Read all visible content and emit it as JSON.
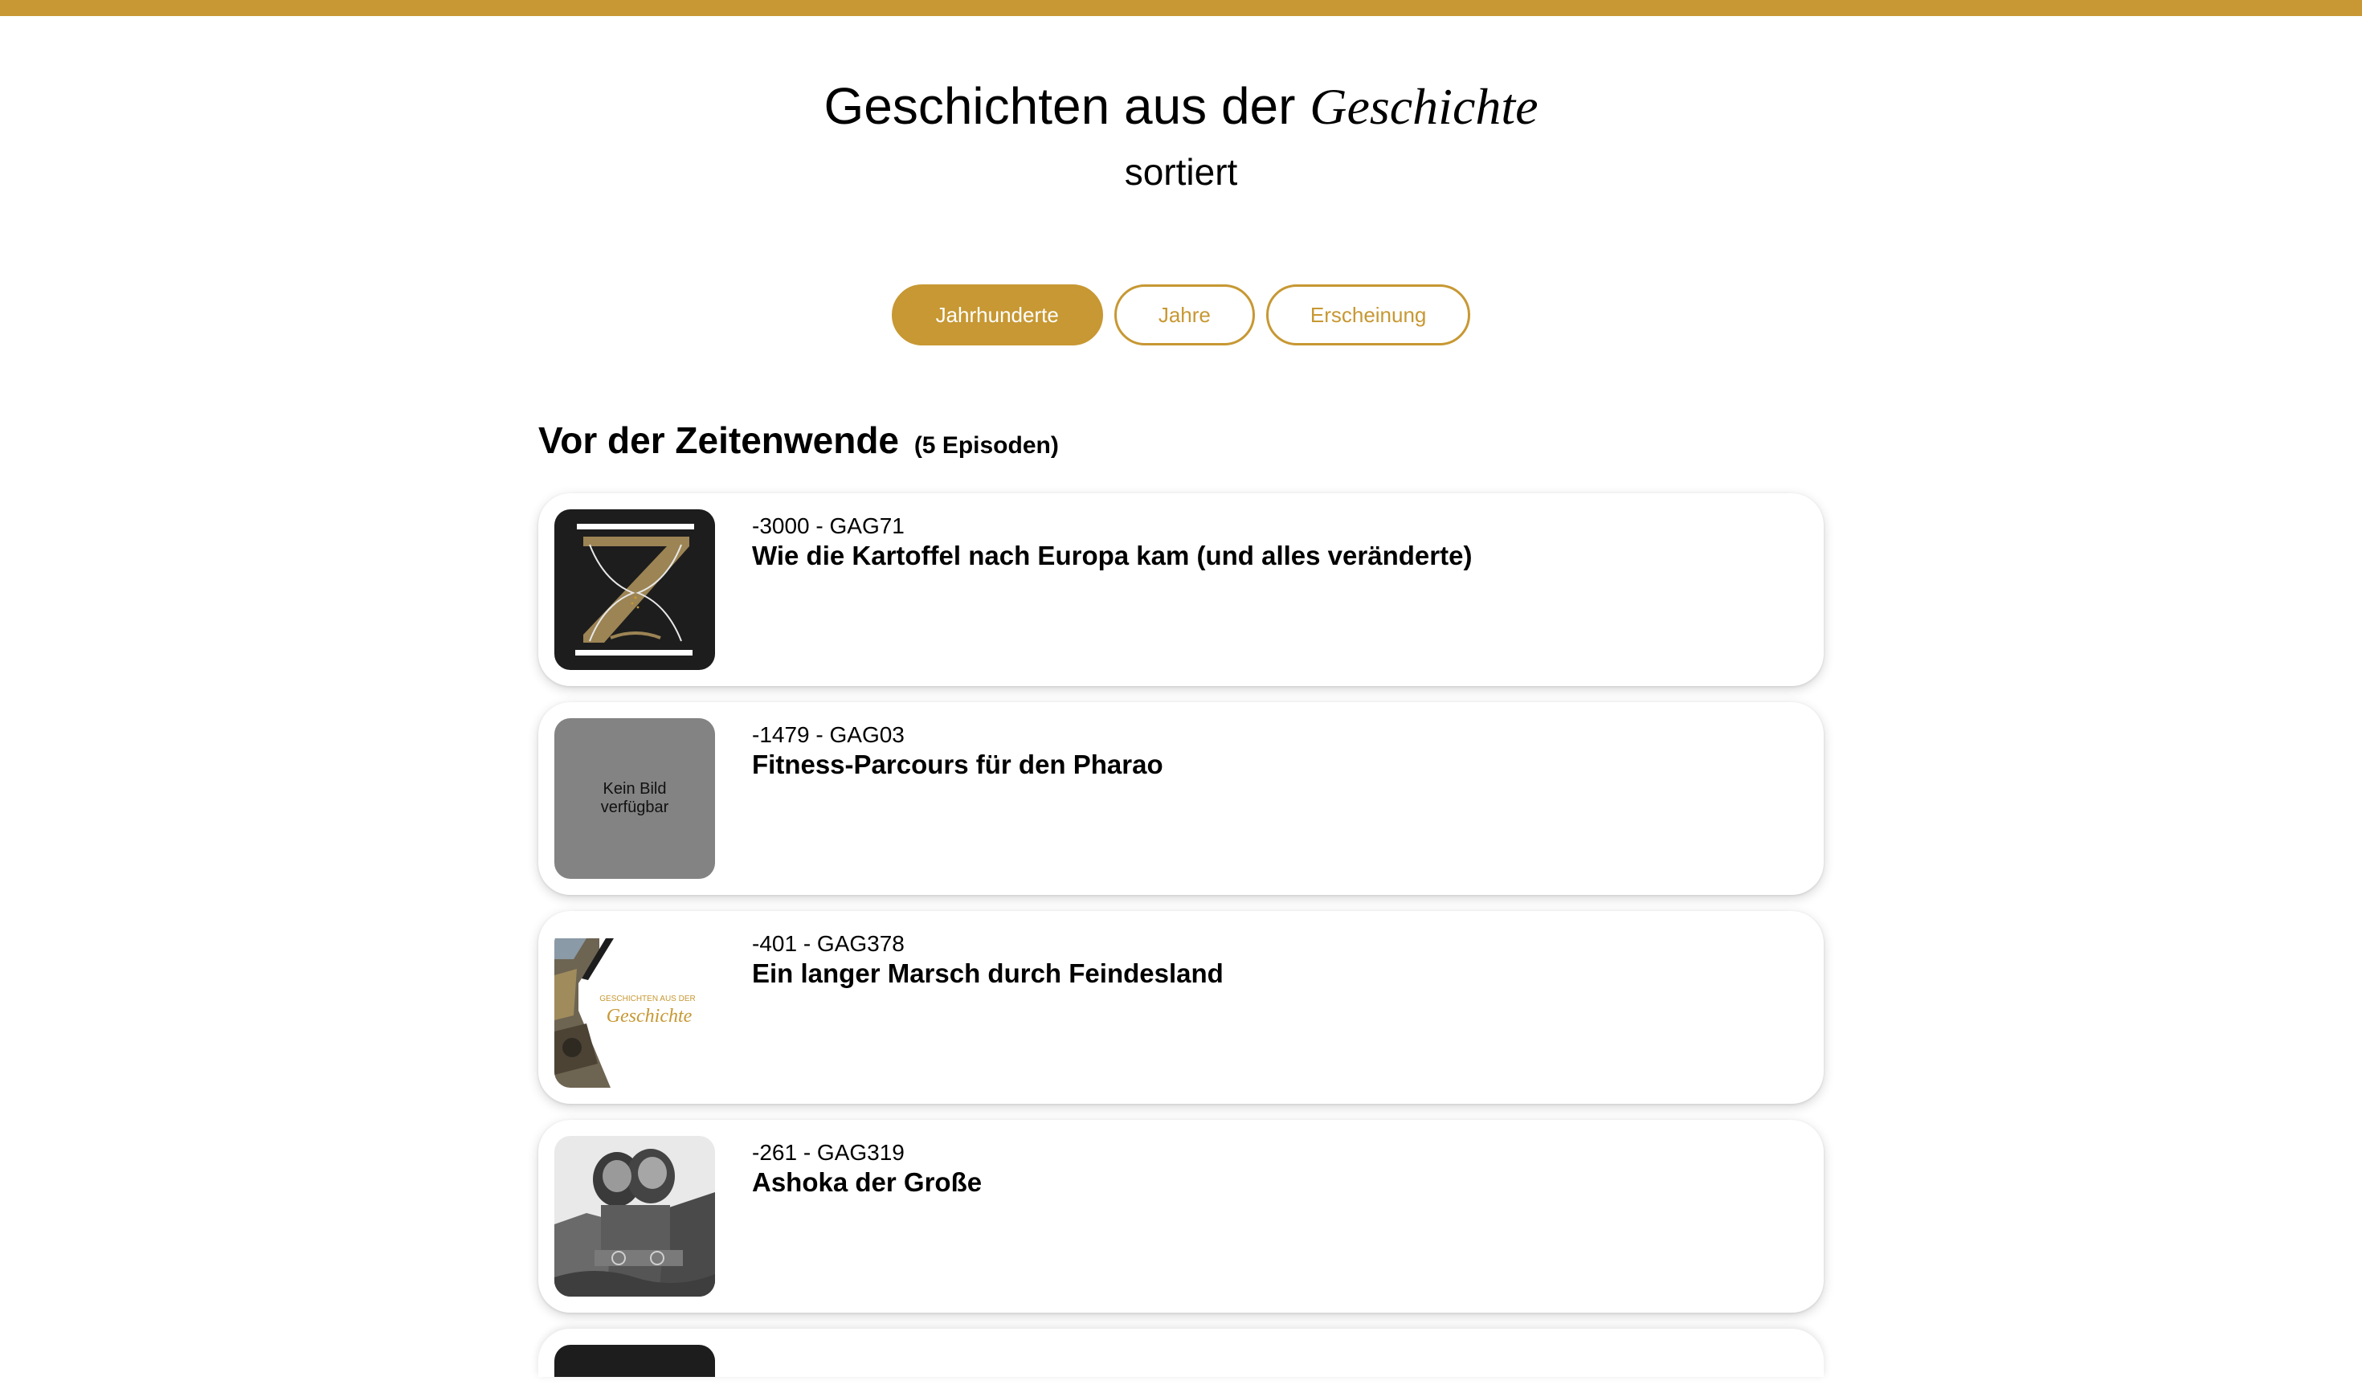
{
  "header": {
    "title_sans": "Geschichten aus der",
    "title_serif": "Geschichte",
    "subtitle": "sortiert"
  },
  "tabs": [
    {
      "label": "Jahrhunderte",
      "active": true
    },
    {
      "label": "Jahre",
      "active": false
    },
    {
      "label": "Erscheinung",
      "active": false
    }
  ],
  "section": {
    "title": "Vor der Zeitenwende",
    "count": "(5 Episoden)"
  },
  "episodes": [
    {
      "meta": "-3000 - GAG71",
      "title": "Wie die Kartoffel nach Europa kam (und alles veränderte)",
      "thumb": "hourglass-logo"
    },
    {
      "meta": "-1479 - GAG03",
      "title": "Fitness-Parcours für den Pharao",
      "thumb": "placeholder",
      "placeholder_text": "Kein Bild verfügbar"
    },
    {
      "meta": "-401 - GAG378",
      "title": "Ein langer Marsch durch Feindesland",
      "thumb": "podcast-cover",
      "cover_small": "GESCHICHTEN AUS DER",
      "cover_large": "Geschichte"
    },
    {
      "meta": "-261 - GAG319",
      "title": "Ashoka der Große",
      "thumb": "lion-capital-photo"
    }
  ],
  "colors": {
    "accent": "#c79833",
    "placeholder_bg": "#838383",
    "dark_thumb": "#1d1d1d"
  }
}
